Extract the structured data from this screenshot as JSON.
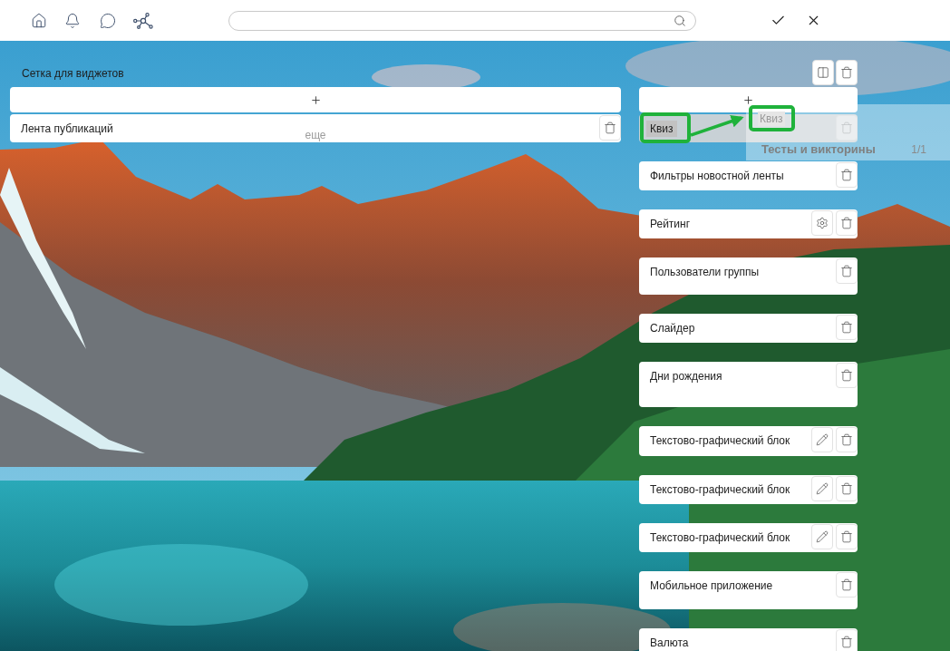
{
  "grid": {
    "title": "Сетка для виджетов",
    "actions": [
      {
        "kind": "columns"
      },
      {
        "kind": "delete"
      }
    ],
    "left_column": {
      "widgets": [
        {
          "name": "Лента публикаций",
          "more": "еще",
          "dragging": false,
          "actions": [
            {
              "kind": "delete"
            }
          ]
        }
      ]
    },
    "right_column": {
      "widgets": [
        {
          "name": "Квиз",
          "dragging": true,
          "actions": [
            {
              "kind": "delete"
            }
          ]
        },
        {
          "name": "Фильтры новостной ленты",
          "dragging": false,
          "actions": [
            {
              "kind": "delete"
            }
          ]
        },
        {
          "name": "Рейтинг",
          "dragging": false,
          "actions": [
            {
              "kind": "settings"
            },
            {
              "kind": "delete"
            }
          ]
        },
        {
          "name": "Пользователи группы",
          "dragging": false,
          "actions": [
            {
              "kind": "delete"
            }
          ]
        },
        {
          "name": "Слайдер",
          "dragging": false,
          "actions": [
            {
              "kind": "delete"
            }
          ]
        },
        {
          "name": "Дни рождения",
          "dragging": false,
          "actions": [
            {
              "kind": "delete"
            }
          ]
        },
        {
          "name": "Текстово-графический блок",
          "dragging": false,
          "actions": [
            {
              "kind": "edit"
            },
            {
              "kind": "delete"
            }
          ]
        },
        {
          "name": "Текстово-графический блок",
          "dragging": false,
          "actions": [
            {
              "kind": "edit"
            },
            {
              "kind": "delete"
            }
          ]
        },
        {
          "name": "Текстово-графический блок",
          "dragging": false,
          "actions": [
            {
              "kind": "edit"
            },
            {
              "kind": "delete"
            }
          ]
        },
        {
          "name": "Мобильное приложение",
          "dragging": false,
          "actions": [
            {
              "kind": "delete"
            }
          ]
        },
        {
          "name": "Валюта",
          "dragging": false,
          "actions": [
            {
              "kind": "delete"
            }
          ]
        }
      ]
    }
  },
  "drag_preview": {
    "label": "Квиз",
    "title": "Тесты и викторины",
    "counter": "1/1"
  }
}
